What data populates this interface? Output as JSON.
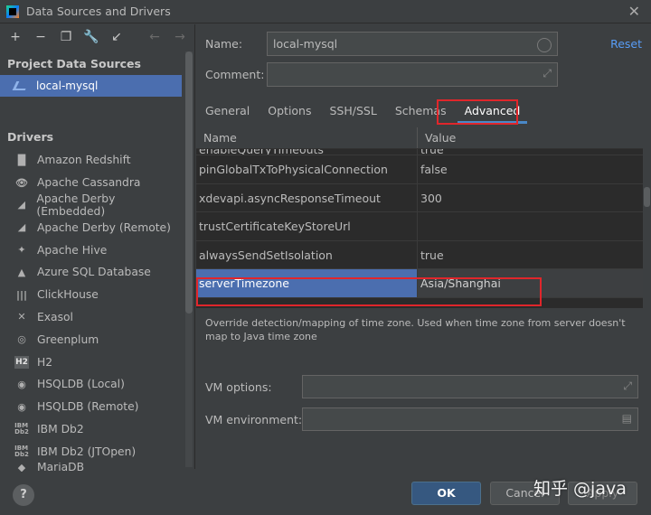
{
  "window": {
    "title": "Data Sources and Drivers"
  },
  "toolbar": {
    "icons": [
      "add-icon",
      "remove-icon",
      "duplicate-icon",
      "wrench-icon",
      "import-icon",
      "back-arrow-icon",
      "forward-arrow-icon"
    ]
  },
  "sidebar": {
    "project_title": "Project Data Sources",
    "selected_source": "local-mysql",
    "drivers_title": "Drivers",
    "drivers": [
      "Amazon Redshift",
      "Apache Cassandra",
      "Apache Derby (Embedded)",
      "Apache Derby (Remote)",
      "Apache Hive",
      "Azure SQL Database",
      "ClickHouse",
      "Exasol",
      "Greenplum",
      "H2",
      "HSQLDB (Local)",
      "HSQLDB (Remote)",
      "IBM Db2",
      "IBM Db2 (JTOpen)",
      "MariaDB"
    ]
  },
  "form": {
    "name_label": "Name:",
    "name_value": "local-mysql",
    "comment_label": "Comment:",
    "comment_value": "",
    "reset_link": "Reset"
  },
  "tabs": [
    "General",
    "Options",
    "SSH/SSL",
    "Schemas",
    "Advanced"
  ],
  "active_tab": "Advanced",
  "table": {
    "headers": {
      "name": "Name",
      "value": "Value"
    },
    "partial_row": {
      "name": "enableQueryTimeouts",
      "value": "true"
    },
    "rows": [
      {
        "name": "pinGlobalTxToPhysicalConnection",
        "value": "false"
      },
      {
        "name": "xdevapi.asyncResponseTimeout",
        "value": "300"
      },
      {
        "name": "trustCertificateKeyStoreUrl",
        "value": ""
      },
      {
        "name": "alwaysSendSetIsolation",
        "value": "true"
      },
      {
        "name": "serverTimezone",
        "value": "Asia/Shanghai"
      }
    ],
    "selected_row": "serverTimezone"
  },
  "description": "Override detection/mapping of time zone. Used when time zone from server doesn't map to Java time zone",
  "vm": {
    "options_label": "VM options:",
    "options_value": "",
    "env_label": "VM environment:",
    "env_value": ""
  },
  "buttons": {
    "help": "?",
    "ok": "OK",
    "cancel": "Cancel",
    "apply": "Apply"
  },
  "watermark": "知乎 @java",
  "colors": {
    "selection": "#4b6eaf",
    "highlight_box": "#e0262b",
    "link": "#589df6",
    "primary_button": "#365880"
  }
}
